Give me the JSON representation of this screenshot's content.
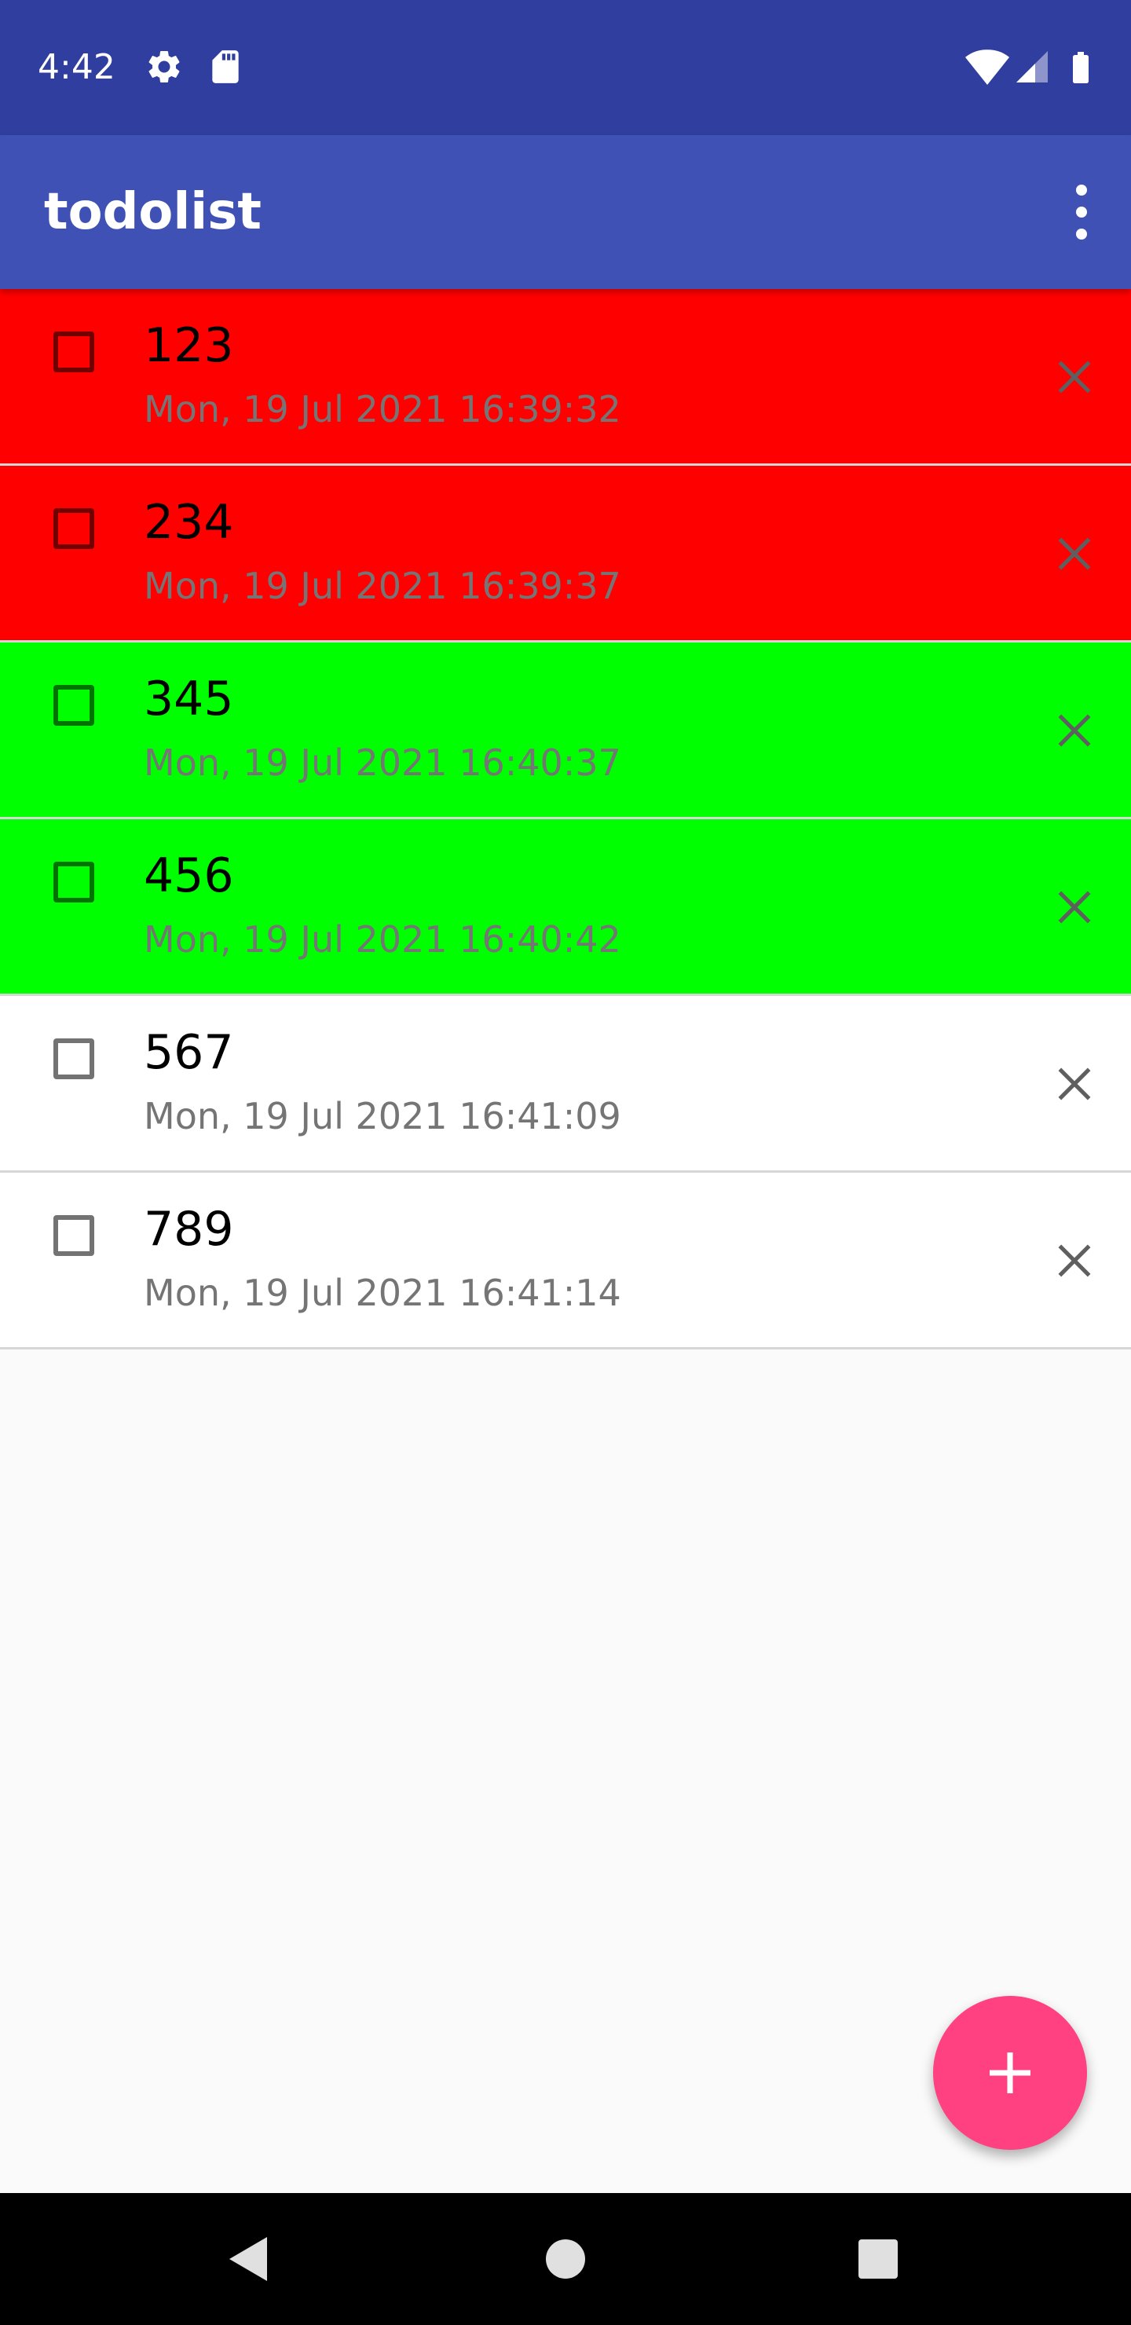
{
  "status_bar": {
    "time": "4:42",
    "icons": [
      "settings-icon",
      "sd-card-icon",
      "wifi-icon",
      "cell-signal-icon",
      "battery-icon"
    ]
  },
  "app_bar": {
    "title": "todolist",
    "menu_icon": "more-vert-icon",
    "background_color": "#3f51b5",
    "status_bar_color": "#303f9f"
  },
  "todos": [
    {
      "title": "123",
      "timestamp": "Mon, 19 Jul 2021 16:39:32",
      "checked": false,
      "background_color": "#ff0000"
    },
    {
      "title": "234",
      "timestamp": "Mon, 19 Jul 2021 16:39:37",
      "checked": false,
      "background_color": "#ff0000"
    },
    {
      "title": "345",
      "timestamp": "Mon, 19 Jul 2021 16:40:37",
      "checked": false,
      "background_color": "#00ff00"
    },
    {
      "title": "456",
      "timestamp": "Mon, 19 Jul 2021 16:40:42",
      "checked": false,
      "background_color": "#00ff00"
    },
    {
      "title": "567",
      "timestamp": "Mon, 19 Jul 2021 16:41:09",
      "checked": false,
      "background_color": "#ffffff"
    },
    {
      "title": "789",
      "timestamp": "Mon, 19 Jul 2021 16:41:14",
      "checked": false,
      "background_color": "#ffffff"
    }
  ],
  "fab": {
    "icon": "plus-icon",
    "color": "#ff4081"
  },
  "nav_bar": {
    "icons": [
      "back-icon",
      "home-icon",
      "recents-icon"
    ]
  }
}
